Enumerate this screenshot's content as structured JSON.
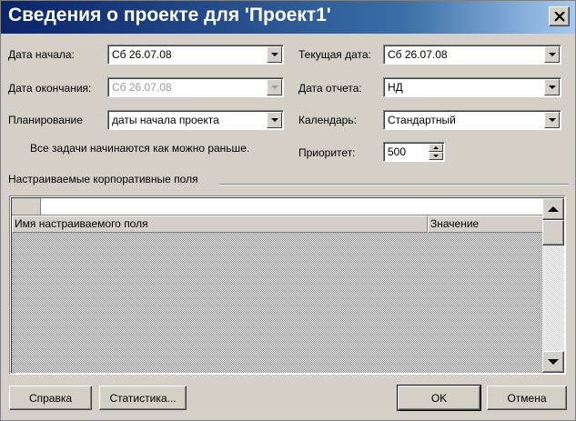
{
  "window": {
    "title": "Сведения о проекте для 'Проект1'"
  },
  "form": {
    "start_date": {
      "label": "Дата начала:",
      "value": "Сб 26.07.08"
    },
    "finish_date": {
      "label": "Дата окончания:",
      "value": "Сб 26.07.08"
    },
    "scheduling": {
      "label": "Планирование",
      "value": "даты начала проекта"
    },
    "scheduling_note": "Все задачи начинаются как можно раньше.",
    "current_date": {
      "label": "Текущая дата:",
      "value": "Сб 26.07.08"
    },
    "status_date": {
      "label": "Дата отчета:",
      "value": "НД"
    },
    "calendar": {
      "label": "Календарь:",
      "value": "Стандартный"
    },
    "priority": {
      "label": "Приоритет:",
      "value": "500"
    }
  },
  "custom_fields": {
    "group_label": "Настраиваемые корпоративные поля",
    "columns": [
      "Имя настраиваемого поля",
      "Значение"
    ]
  },
  "buttons": {
    "help": "Справка",
    "statistics": "Статистика...",
    "ok": "OK",
    "cancel": "Отмена"
  },
  "icons": {
    "close": "close-icon",
    "dropdown": "chevron-down-icon",
    "spin_up": "spin-up-icon",
    "spin_down": "spin-down-icon",
    "scroll_up": "scroll-up-icon",
    "scroll_down": "scroll-down-icon"
  }
}
